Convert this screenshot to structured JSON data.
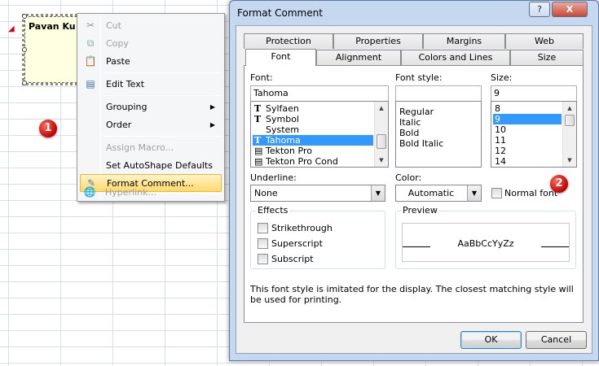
{
  "spreadsheet": {
    "comment_text": "Pavan Ku",
    "badge1": "1",
    "badge2": "2"
  },
  "context_menu": {
    "items": [
      {
        "label": "Cut",
        "icon": "scissors-icon",
        "enabled": false
      },
      {
        "label": "Copy",
        "icon": "copy-icon",
        "enabled": false
      },
      {
        "label": "Paste",
        "icon": "paste-icon",
        "enabled": true
      },
      {
        "label": "Edit Text",
        "icon": "edit-text-icon",
        "enabled": true
      },
      {
        "label": "Grouping",
        "enabled": true,
        "submenu": true
      },
      {
        "label": "Order",
        "enabled": true,
        "submenu": true
      },
      {
        "label": "Assign Macro...",
        "enabled": false
      },
      {
        "label": "Set AutoShape Defaults",
        "enabled": true
      },
      {
        "label": "Format Comment...",
        "icon": "format-comment-icon",
        "enabled": true,
        "highlighted": true
      },
      {
        "label": "Hyperlink...",
        "icon": "hyperlink-icon",
        "enabled": false
      }
    ]
  },
  "dialog": {
    "title": "Format Comment",
    "help_label": "?",
    "close_label": "X",
    "tabs_row1": [
      "Protection",
      "Properties",
      "Margins",
      "Web"
    ],
    "tabs_row2": [
      "Font",
      "Alignment",
      "Colors and Lines",
      "Size"
    ],
    "active_tab": "Font",
    "font": {
      "label": "Font:",
      "value": "Tahoma",
      "list": [
        "Sylfaen",
        "Symbol",
        "System",
        "Tahoma",
        "Tekton Pro",
        "Tekton Pro Cond"
      ],
      "selected": "Tahoma"
    },
    "font_style": {
      "label": "Font style:",
      "value": "",
      "list": [
        "Regular",
        "Italic",
        "Bold",
        "Bold Italic"
      ]
    },
    "size": {
      "label": "Size:",
      "value": "9",
      "list": [
        "8",
        "9",
        "10",
        "11",
        "12",
        "14"
      ],
      "selected": "9"
    },
    "underline": {
      "label": "Underline:",
      "value": "None"
    },
    "color": {
      "label": "Color:",
      "value": "Automatic"
    },
    "normal_font": {
      "label": "Normal font",
      "checked": false
    },
    "effects": {
      "label": "Effects",
      "items": [
        "Strikethrough",
        "Superscript",
        "Subscript"
      ]
    },
    "preview": {
      "label": "Preview",
      "sample": "AaBbCcYyZz"
    },
    "note": "This font style is imitated for the display.  The closest matching style will be used for printing.",
    "ok_label": "OK",
    "cancel_label": "Cancel"
  }
}
